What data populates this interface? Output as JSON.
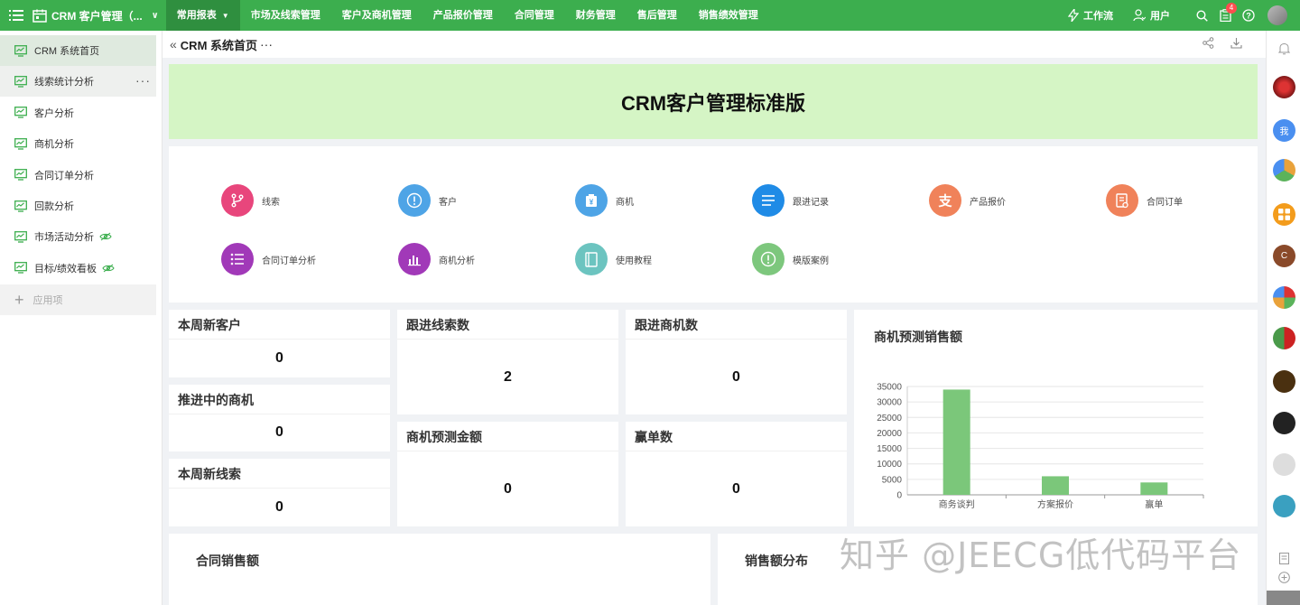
{
  "app": {
    "title": "CRM 客户管理（..."
  },
  "topnav": [
    {
      "label": "常用报表",
      "active": true,
      "caret": "▼"
    },
    {
      "label": "市场及线索管理"
    },
    {
      "label": "客户及商机管理"
    },
    {
      "label": "产品报价管理"
    },
    {
      "label": "合同管理"
    },
    {
      "label": "财务管理"
    },
    {
      "label": "售后管理"
    },
    {
      "label": "销售绩效管理"
    }
  ],
  "header_right": {
    "workflow": "工作流",
    "user": "用户",
    "notification_count": "4"
  },
  "sidebar": {
    "items": [
      {
        "label": "CRM 系统首页"
      },
      {
        "label": "线索统计分析",
        "more": "···"
      },
      {
        "label": "客户分析"
      },
      {
        "label": "商机分析"
      },
      {
        "label": "合同订单分析"
      },
      {
        "label": "回款分析"
      },
      {
        "label": "市场活动分析"
      },
      {
        "label": "目标/绩效看板"
      }
    ],
    "add_label": "应用项"
  },
  "tab": {
    "back": "«",
    "title": "CRM 系统首页",
    "dots": "···"
  },
  "banner": {
    "title": "CRM客户管理标准版"
  },
  "quick_links": [
    {
      "label": "线索",
      "color": "#e8467c",
      "icon": "branch-icon"
    },
    {
      "label": "客户",
      "color": "#4ea4e6",
      "icon": "info-icon"
    },
    {
      "label": "商机",
      "color": "#4ea4e6",
      "icon": "yen-bag-icon"
    },
    {
      "label": "跟进记录",
      "color": "#1f8be6",
      "icon": "list-lines-icon"
    },
    {
      "label": "产品报价",
      "color": "#f0825a",
      "icon": "alipay-icon"
    },
    {
      "label": "合同订单",
      "color": "#f0825a",
      "icon": "receipt-icon"
    },
    {
      "label": "合同订单分析",
      "color": "#a139b8",
      "icon": "bullet-list-icon"
    },
    {
      "label": "商机分析",
      "color": "#a139b8",
      "icon": "bar-chart-icon"
    },
    {
      "label": "使用教程",
      "color": "#6cc4c0",
      "icon": "book-icon"
    },
    {
      "label": "模版案例",
      "color": "#7dc77d",
      "icon": "info-icon"
    }
  ],
  "stats": {
    "new_customers": {
      "title": "本周新客户",
      "value": "0"
    },
    "follow_leads": {
      "title": "跟进线索数",
      "value": "2"
    },
    "follow_opps": {
      "title": "跟进商机数",
      "value": "0"
    },
    "ongoing_opps": {
      "title": "推进中的商机",
      "value": "0"
    },
    "forecast_amount": {
      "title": "商机预测金额",
      "value": "0"
    },
    "won_count": {
      "title": "赢单数",
      "value": "0"
    },
    "new_leads": {
      "title": "本周新线索",
      "value": "0"
    }
  },
  "chart_data": {
    "type": "bar",
    "title": "商机预测销售额",
    "categories": [
      "商务谈判",
      "方案报价",
      "赢单"
    ],
    "values": [
      34000,
      6000,
      4000
    ],
    "ylim": [
      0,
      35000
    ],
    "yticks": [
      "35000",
      "30000",
      "25000",
      "20000",
      "15000",
      "10000",
      "5000",
      "0"
    ],
    "bar_color": "#7bc77a",
    "grid": true
  },
  "bottom_cards": {
    "contract_sales": "合同销售额",
    "sales_distribution": "销售额分布"
  },
  "watermark": "知乎 @JEECG低代码平台"
}
